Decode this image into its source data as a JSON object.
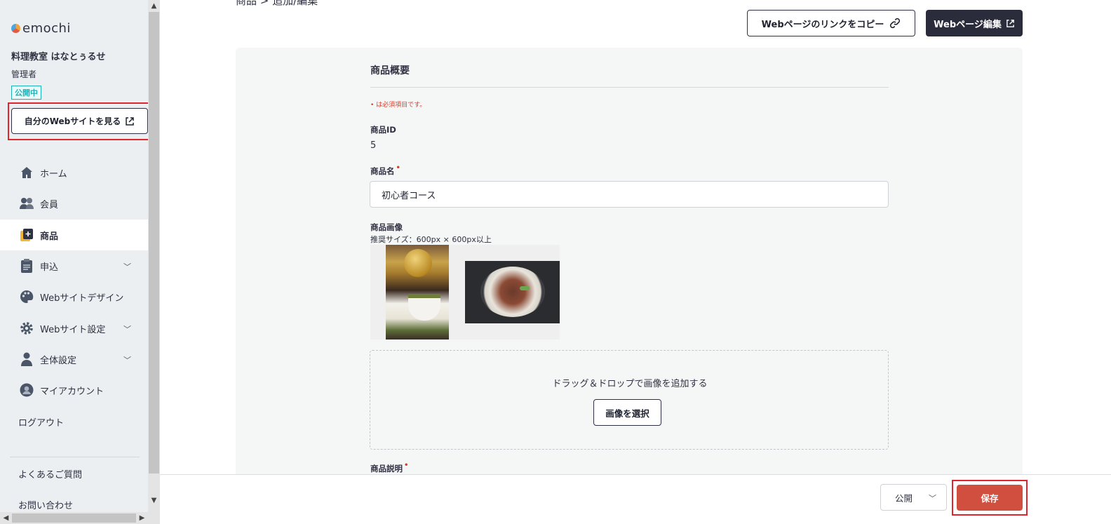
{
  "sidebar": {
    "logo_text": "emochi",
    "school_name": "料理教室 はなとぅるせ",
    "role": "管理者",
    "status_badge": "公開中",
    "my_site_button": "自分のWebサイトを見る",
    "nav": [
      {
        "label": "ホーム",
        "icon": "home-icon"
      },
      {
        "label": "会員",
        "icon": "members-icon"
      },
      {
        "label": "商品",
        "icon": "product-icon",
        "active": true
      },
      {
        "label": "申込",
        "icon": "clipboard-icon",
        "expandable": true
      },
      {
        "label": "Webサイトデザイン",
        "icon": "palette-icon"
      },
      {
        "label": "Webサイト設定",
        "icon": "gear-icon",
        "expandable": true
      },
      {
        "label": "全体設定",
        "icon": "person-icon",
        "expandable": true
      },
      {
        "label": "マイアカウント",
        "icon": "account-icon"
      }
    ],
    "logout": "ログアウト",
    "faq": "よくあるご質問",
    "contact": "お問い合わせ"
  },
  "header": {
    "breadcrumb_cut": "商品 > 追加/編集",
    "copy_link_button": "Webページのリンクをコピー",
    "edit_page_button": "Webページ編集"
  },
  "form": {
    "section_title": "商品概要",
    "required_note": "• は必須項目です。",
    "product_id_label": "商品ID",
    "product_id_value": "5",
    "product_name_label": "商品名",
    "product_name_value": "初心者コース",
    "image_label": "商品画像",
    "image_hint": "推奨サイズ：600px × 600px以上",
    "dropzone_text": "ドラッグ＆ドロップで画像を追加する",
    "select_image_button": "画像を選択",
    "description_label": "商品説明"
  },
  "footer": {
    "status_value": "公開",
    "save_button": "保存"
  },
  "colors": {
    "accent_dark": "#2a2b3b",
    "save_red": "#d14f3e",
    "badge_teal": "#1eb1b7",
    "required_red": "#d43d2a",
    "highlight_box": "#e0262c"
  }
}
